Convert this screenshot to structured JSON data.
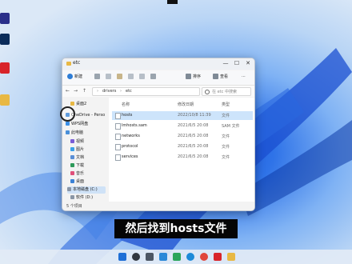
{
  "window": {
    "title": "etc",
    "minimize_glyph": "—",
    "maximize_glyph": "☐",
    "close_glyph": "✕"
  },
  "toolbar": {
    "new_label": "新建",
    "sort_label": "排序",
    "view_label": "查看",
    "more_glyph": "···"
  },
  "addressbar": {
    "back_glyph": "←",
    "forward_glyph": "→",
    "up_glyph": "↑",
    "path": [
      "drivers",
      "etc"
    ],
    "separator": "›",
    "search_placeholder": "在 etc 中搜索"
  },
  "sidebar": {
    "items": [
      {
        "label": "桌面2",
        "icon": "folder-icon",
        "color": "#e8b844"
      },
      {
        "label": "OneDrive - Perso",
        "icon": "cloud-icon",
        "color": "#2b7cd3"
      },
      {
        "label": "WPS网盘",
        "icon": "cloud-icon",
        "color": "#3a8ee6"
      },
      {
        "label": "此电脑",
        "icon": "computer-icon",
        "color": "#4a90d9"
      },
      {
        "label": "视频",
        "icon": "video-icon",
        "color": "#7a5cd6"
      },
      {
        "label": "图片",
        "icon": "picture-icon",
        "color": "#3aa0e8"
      },
      {
        "label": "文档",
        "icon": "document-icon",
        "color": "#5a8fd6"
      },
      {
        "label": "下载",
        "icon": "download-icon",
        "color": "#2e9a5a"
      },
      {
        "label": "音乐",
        "icon": "music-icon",
        "color": "#e0507a"
      },
      {
        "label": "桌面",
        "icon": "desktop-icon",
        "color": "#3b82d6"
      },
      {
        "label": "本地磁盘 (C:)",
        "icon": "drive-icon",
        "color": "#8a96a6"
      },
      {
        "label": "软件 (D:)",
        "icon": "drive-icon",
        "color": "#8a96a6"
      }
    ]
  },
  "content": {
    "columns": {
      "name": "名称",
      "date": "修改日期",
      "type": "类型"
    },
    "files": [
      {
        "name": "hosts",
        "date": "2022/10/8 11:39",
        "type": "文件"
      },
      {
        "name": "lmhosts.sam",
        "date": "2021/6/5 20:08",
        "type": "SAM 文件"
      },
      {
        "name": "networks",
        "date": "2021/6/5 20:08",
        "type": "文件"
      },
      {
        "name": "protocol",
        "date": "2021/6/5 20:08",
        "type": "文件"
      },
      {
        "name": "services",
        "date": "2021/6/5 20:08",
        "type": "文件"
      }
    ]
  },
  "statusbar": {
    "text": "5 个项目"
  },
  "caption": {
    "text": "然后找到hosts文件"
  },
  "colors": {
    "accent": "#1a6fd8",
    "selection": "#cde4fb",
    "caption_bg": "#050505"
  }
}
